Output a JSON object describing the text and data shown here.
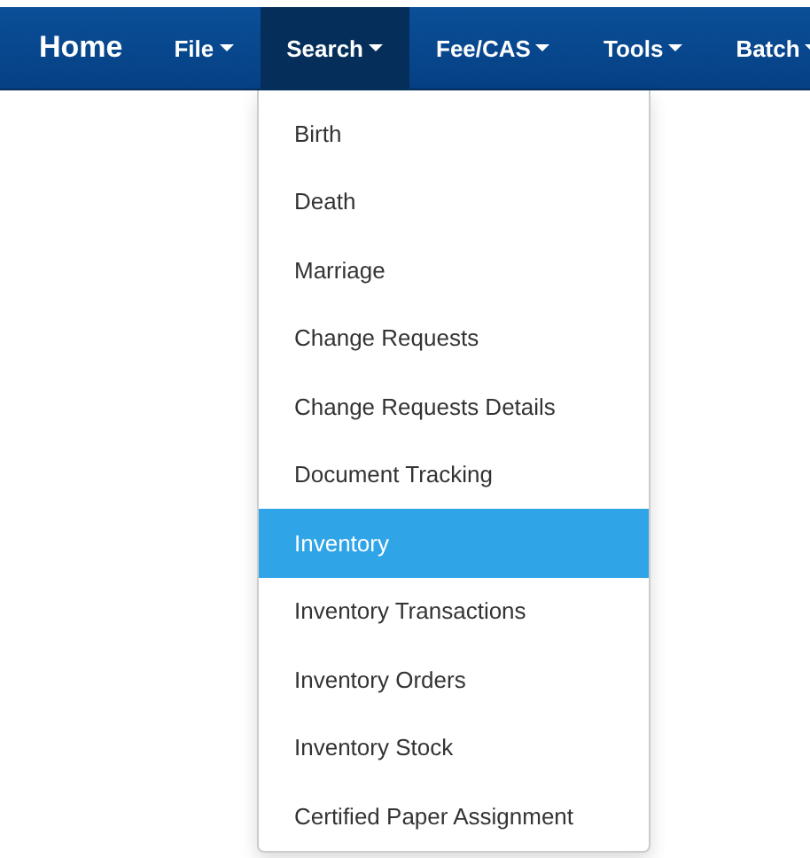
{
  "navbar": {
    "brand": "Home",
    "menus": [
      {
        "label": "File",
        "selected": false
      },
      {
        "label": "Search",
        "selected": true
      },
      {
        "label": "Fee/CAS",
        "selected": false
      },
      {
        "label": "Tools",
        "selected": false
      },
      {
        "label": "Batch",
        "selected": false
      }
    ]
  },
  "dropdown": {
    "items": [
      {
        "label": "Birth",
        "selected": false
      },
      {
        "label": "Death",
        "selected": false
      },
      {
        "label": "Marriage",
        "selected": false
      },
      {
        "label": "Change Requests",
        "selected": false
      },
      {
        "label": "Change Requests Details",
        "selected": false
      },
      {
        "label": "Document Tracking",
        "selected": false
      },
      {
        "label": "Inventory",
        "selected": true
      },
      {
        "label": "Inventory Transactions",
        "selected": false
      },
      {
        "label": "Inventory Orders",
        "selected": false
      },
      {
        "label": "Inventory Stock",
        "selected": false
      },
      {
        "label": "Certified Paper Assignment",
        "selected": false
      }
    ]
  }
}
